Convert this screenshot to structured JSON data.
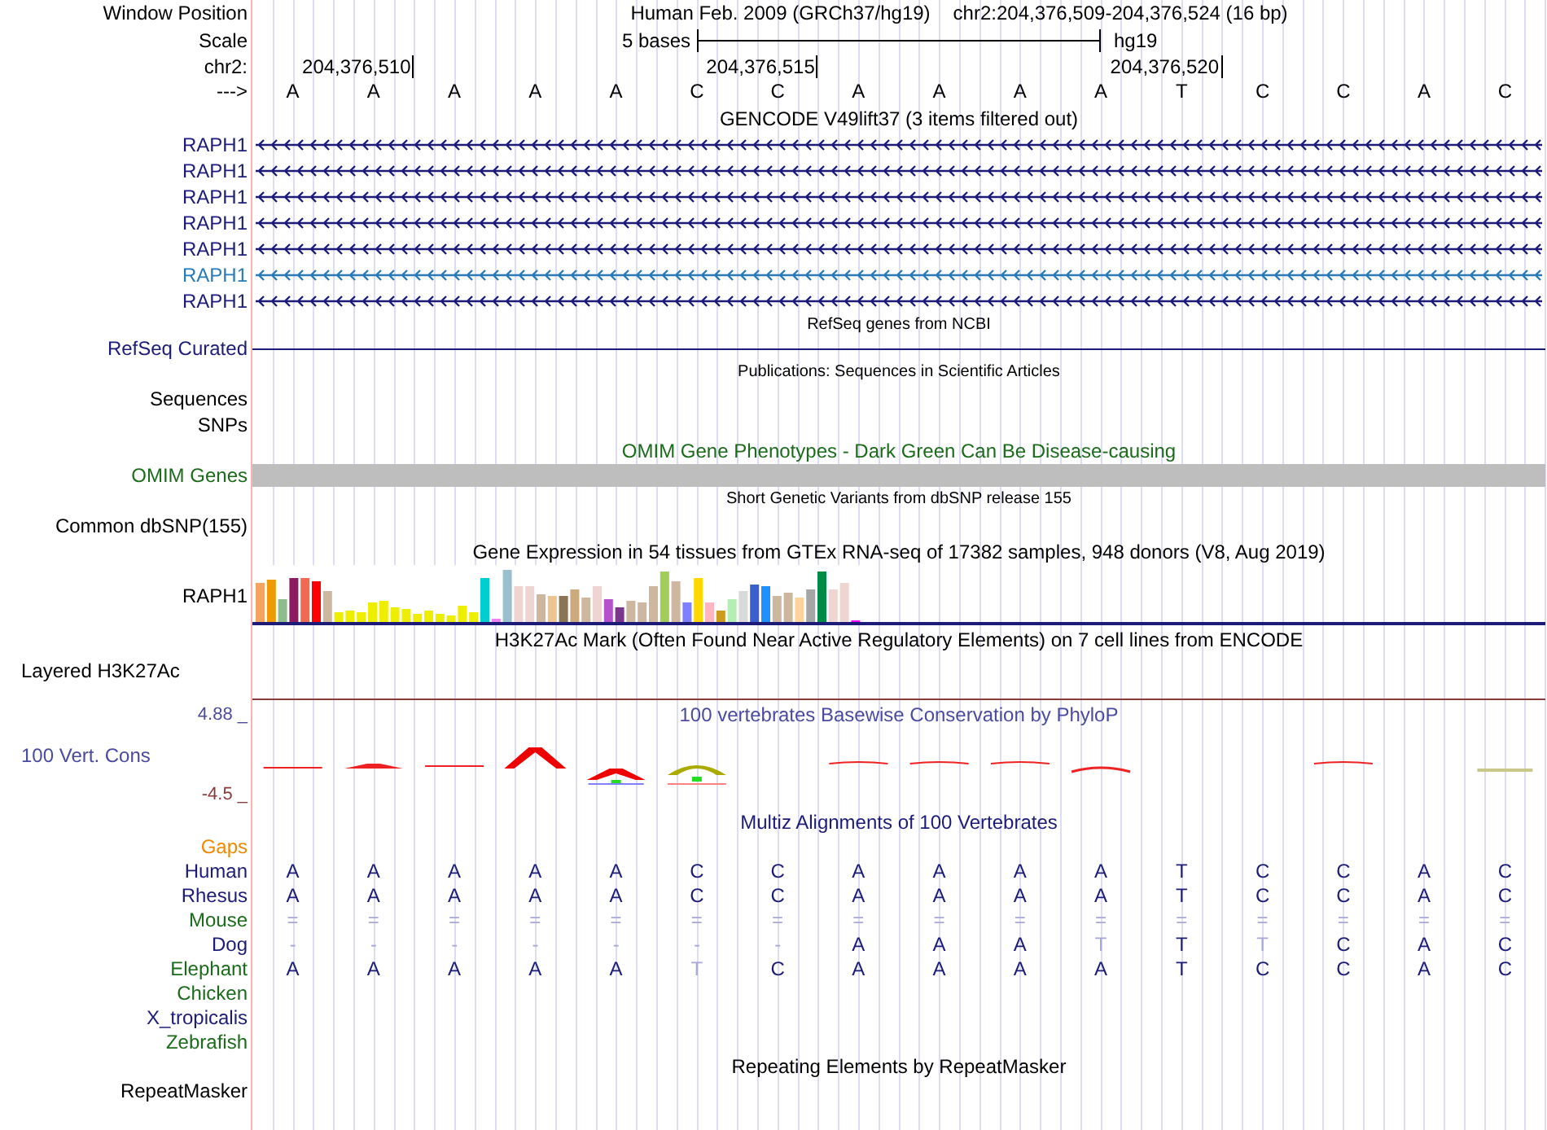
{
  "header": {
    "label": "Window Position",
    "title": "Human Feb. 2009 (GRCh37/hg19)",
    "position": "chr2:204,376,509-204,376,524 (16 bp)"
  },
  "scale": {
    "label": "Scale",
    "bar_label": "5 bases",
    "assembly": "hg19"
  },
  "coordinates": {
    "label": "chr2:",
    "ticks": [
      "204,376,510",
      "204,376,515",
      "204,376,520"
    ]
  },
  "sequence": {
    "label": "--->",
    "bases": [
      "A",
      "A",
      "A",
      "A",
      "A",
      "C",
      "C",
      "A",
      "A",
      "A",
      "A",
      "T",
      "C",
      "C",
      "A",
      "C"
    ]
  },
  "tracks": [
    {
      "kind": "genes",
      "title": "GENCODE V49lift37 (3 items filtered out)",
      "items": [
        {
          "label": "RAPH1",
          "color": "#1c1c78"
        },
        {
          "label": "RAPH1",
          "color": "#1c1c78"
        },
        {
          "label": "RAPH1",
          "color": "#1c1c78"
        },
        {
          "label": "RAPH1",
          "color": "#1c1c78"
        },
        {
          "label": "RAPH1",
          "color": "#1c1c78"
        },
        {
          "label": "RAPH1",
          "color": "#2a7ab8"
        },
        {
          "label": "RAPH1",
          "color": "#1c1c78"
        }
      ]
    },
    {
      "kind": "refseq",
      "title": "RefSeq genes from NCBI",
      "label": "RefSeq Curated"
    },
    {
      "kind": "publications",
      "title": "Publications: Sequences in Scientific Articles",
      "labels": [
        "Sequences",
        "SNPs"
      ]
    },
    {
      "kind": "omim",
      "title": "OMIM Gene Phenotypes - Dark Green Can Be Disease-causing",
      "label": "OMIM Genes"
    },
    {
      "kind": "variants",
      "title": "Short Genetic Variants from dbSNP release 155",
      "label": "Common dbSNP(155)"
    },
    {
      "kind": "expression",
      "title": "Gene Expression in 54 tissues from GTEx RNA-seq of 17382 samples, 948 donors (V8, Aug 2019)",
      "label": "RAPH1"
    },
    {
      "kind": "h3k27ac",
      "title": "H3K27Ac Mark (Often Found Near Active Regulatory Elements) on 7 cell lines from ENCODE",
      "label": "Layered H3K27Ac"
    },
    {
      "kind": "conservation",
      "title": "100 vertebrates Basewise Conservation by PhyloP",
      "label": "100 Vert. Cons",
      "max": "4.88 _",
      "min": "-4.5 _"
    },
    {
      "kind": "alignment",
      "title": "Multiz Alignments of 100 Vertebrates",
      "gaps_label": "Gaps",
      "species": [
        {
          "name": "Human",
          "color": "#1c1c78",
          "bases": [
            {
              "base": "A",
              "faded": false
            },
            {
              "base": "A",
              "faded": false
            },
            {
              "base": "A",
              "faded": false
            },
            {
              "base": "A",
              "faded": false
            },
            {
              "base": "A",
              "faded": false
            },
            {
              "base": "C",
              "faded": false
            },
            {
              "base": "C",
              "faded": false
            },
            {
              "base": "A",
              "faded": false
            },
            {
              "base": "A",
              "faded": false
            },
            {
              "base": "A",
              "faded": false
            },
            {
              "base": "A",
              "faded": false
            },
            {
              "base": "T",
              "faded": false
            },
            {
              "base": "C",
              "faded": false
            },
            {
              "base": "C",
              "faded": false
            },
            {
              "base": "A",
              "faded": false
            },
            {
              "base": "C",
              "faded": false
            }
          ]
        },
        {
          "name": "Rhesus",
          "color": "#1c1c78",
          "bases": [
            {
              "base": "A",
              "faded": false
            },
            {
              "base": "A",
              "faded": false
            },
            {
              "base": "A",
              "faded": false
            },
            {
              "base": "A",
              "faded": false
            },
            {
              "base": "A",
              "faded": false
            },
            {
              "base": "C",
              "faded": false
            },
            {
              "base": "C",
              "faded": false
            },
            {
              "base": "A",
              "faded": false
            },
            {
              "base": "A",
              "faded": false
            },
            {
              "base": "A",
              "faded": false
            },
            {
              "base": "A",
              "faded": false
            },
            {
              "base": "T",
              "faded": false
            },
            {
              "base": "C",
              "faded": false
            },
            {
              "base": "C",
              "faded": false
            },
            {
              "base": "A",
              "faded": false
            },
            {
              "base": "C",
              "faded": false
            }
          ]
        },
        {
          "name": "Mouse",
          "color": "#1a6b1a",
          "bases": [
            {
              "base": "=",
              "faded": true
            },
            {
              "base": "=",
              "faded": true
            },
            {
              "base": "=",
              "faded": true
            },
            {
              "base": "=",
              "faded": true
            },
            {
              "base": "=",
              "faded": true
            },
            {
              "base": "=",
              "faded": true
            },
            {
              "base": "=",
              "faded": true
            },
            {
              "base": "=",
              "faded": true
            },
            {
              "base": "=",
              "faded": true
            },
            {
              "base": "=",
              "faded": true
            },
            {
              "base": "=",
              "faded": true
            },
            {
              "base": "=",
              "faded": true
            },
            {
              "base": "=",
              "faded": true
            },
            {
              "base": "=",
              "faded": true
            },
            {
              "base": "=",
              "faded": true
            },
            {
              "base": "=",
              "faded": true
            }
          ]
        },
        {
          "name": "Dog",
          "color": "#1c1c78",
          "bases": [
            {
              "base": "-",
              "faded": true
            },
            {
              "base": "-",
              "faded": true
            },
            {
              "base": "-",
              "faded": true
            },
            {
              "base": "-",
              "faded": true
            },
            {
              "base": "-",
              "faded": true
            },
            {
              "base": "-",
              "faded": true
            },
            {
              "base": "-",
              "faded": true
            },
            {
              "base": "A",
              "faded": false
            },
            {
              "base": "A",
              "faded": false
            },
            {
              "base": "A",
              "faded": false
            },
            {
              "base": "T",
              "faded": true
            },
            {
              "base": "T",
              "faded": false
            },
            {
              "base": "T",
              "faded": true
            },
            {
              "base": "C",
              "faded": false
            },
            {
              "base": "A",
              "faded": false
            },
            {
              "base": "C",
              "faded": false
            }
          ]
        },
        {
          "name": "Elephant",
          "color": "#1a6b1a",
          "bases": [
            {
              "base": "A",
              "faded": false
            },
            {
              "base": "A",
              "faded": false
            },
            {
              "base": "A",
              "faded": false
            },
            {
              "base": "A",
              "faded": false
            },
            {
              "base": "A",
              "faded": false
            },
            {
              "base": "T",
              "faded": true
            },
            {
              "base": "C",
              "faded": false
            },
            {
              "base": "A",
              "faded": false
            },
            {
              "base": "A",
              "faded": false
            },
            {
              "base": "A",
              "faded": false
            },
            {
              "base": "A",
              "faded": false
            },
            {
              "base": "T",
              "faded": false
            },
            {
              "base": "C",
              "faded": false
            },
            {
              "base": "C",
              "faded": false
            },
            {
              "base": "A",
              "faded": false
            },
            {
              "base": "C",
              "faded": false
            }
          ]
        },
        {
          "name": "Chicken",
          "color": "#1a6b1a"
        },
        {
          "name": "X_tropicalis",
          "color": "#1c1c78"
        },
        {
          "name": "Zebrafish",
          "color": "#1a6b1a"
        }
      ]
    },
    {
      "kind": "repeats",
      "title": "Repeating Elements by RepeatMasker",
      "label": "RepeatMasker"
    }
  ]
}
